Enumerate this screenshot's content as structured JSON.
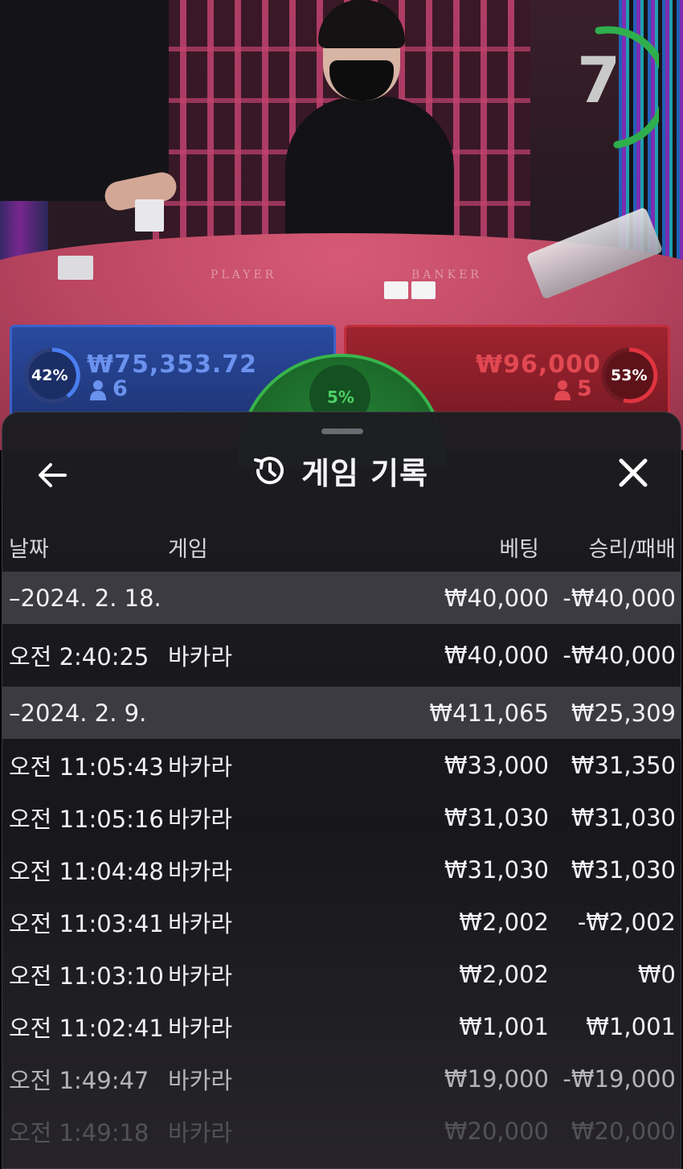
{
  "live_view": {
    "countdown": "7",
    "table_labels": {
      "player": "PLAYER",
      "banker": "BANKER"
    },
    "player": {
      "percent": "42%",
      "amount": "₩75,353.72",
      "count": "6",
      "color": "#3a61c9"
    },
    "banker": {
      "percent": "53%",
      "amount": "₩96,000",
      "count": "5",
      "color": "#c12f3c"
    },
    "tie": {
      "percent": "5%",
      "color": "#38b54c"
    }
  },
  "sheet": {
    "title": "게임 기록",
    "icons": {
      "back": "arrow-left-icon",
      "title": "history-icon",
      "close": "close-icon"
    },
    "columns": {
      "date": "날짜",
      "game": "게임",
      "bet": "베팅",
      "result": "승리/패배"
    },
    "rows": [
      {
        "type": "day",
        "date": "–2024. 2. 18.",
        "game": "",
        "bet": "₩40,000",
        "result": "-₩40,000"
      },
      {
        "type": "game",
        "date": "오전 2:40:25",
        "game": "바카라",
        "bet": "₩40,000",
        "result": "-₩40,000"
      },
      {
        "type": "day",
        "date": "–2024. 2. 9.",
        "game": "",
        "bet": "₩411,065",
        "result": "₩25,309"
      },
      {
        "type": "game",
        "date": "오전 11:05:43",
        "game": "바카라",
        "bet": "₩33,000",
        "result": "₩31,350"
      },
      {
        "type": "game",
        "date": "오전 11:05:16",
        "game": "바카라",
        "bet": "₩31,030",
        "result": "₩31,030"
      },
      {
        "type": "game",
        "date": "오전 11:04:48",
        "game": "바카라",
        "bet": "₩31,030",
        "result": "₩31,030"
      },
      {
        "type": "game",
        "date": "오전 11:03:41",
        "game": "바카라",
        "bet": "₩2,002",
        "result": "-₩2,002"
      },
      {
        "type": "game",
        "date": "오전 11:03:10",
        "game": "바카라",
        "bet": "₩2,002",
        "result": "₩0"
      },
      {
        "type": "game",
        "date": "오전 11:02:41",
        "game": "바카라",
        "bet": "₩1,001",
        "result": "₩1,001"
      },
      {
        "type": "game",
        "date": "오전 1:49:47",
        "game": "바카라",
        "bet": "₩19,000",
        "result": "-₩19,000"
      },
      {
        "type": "game",
        "date": "오전 1:49:18",
        "game": "바카라",
        "bet": "₩20,000",
        "result": "₩20,000"
      }
    ]
  }
}
